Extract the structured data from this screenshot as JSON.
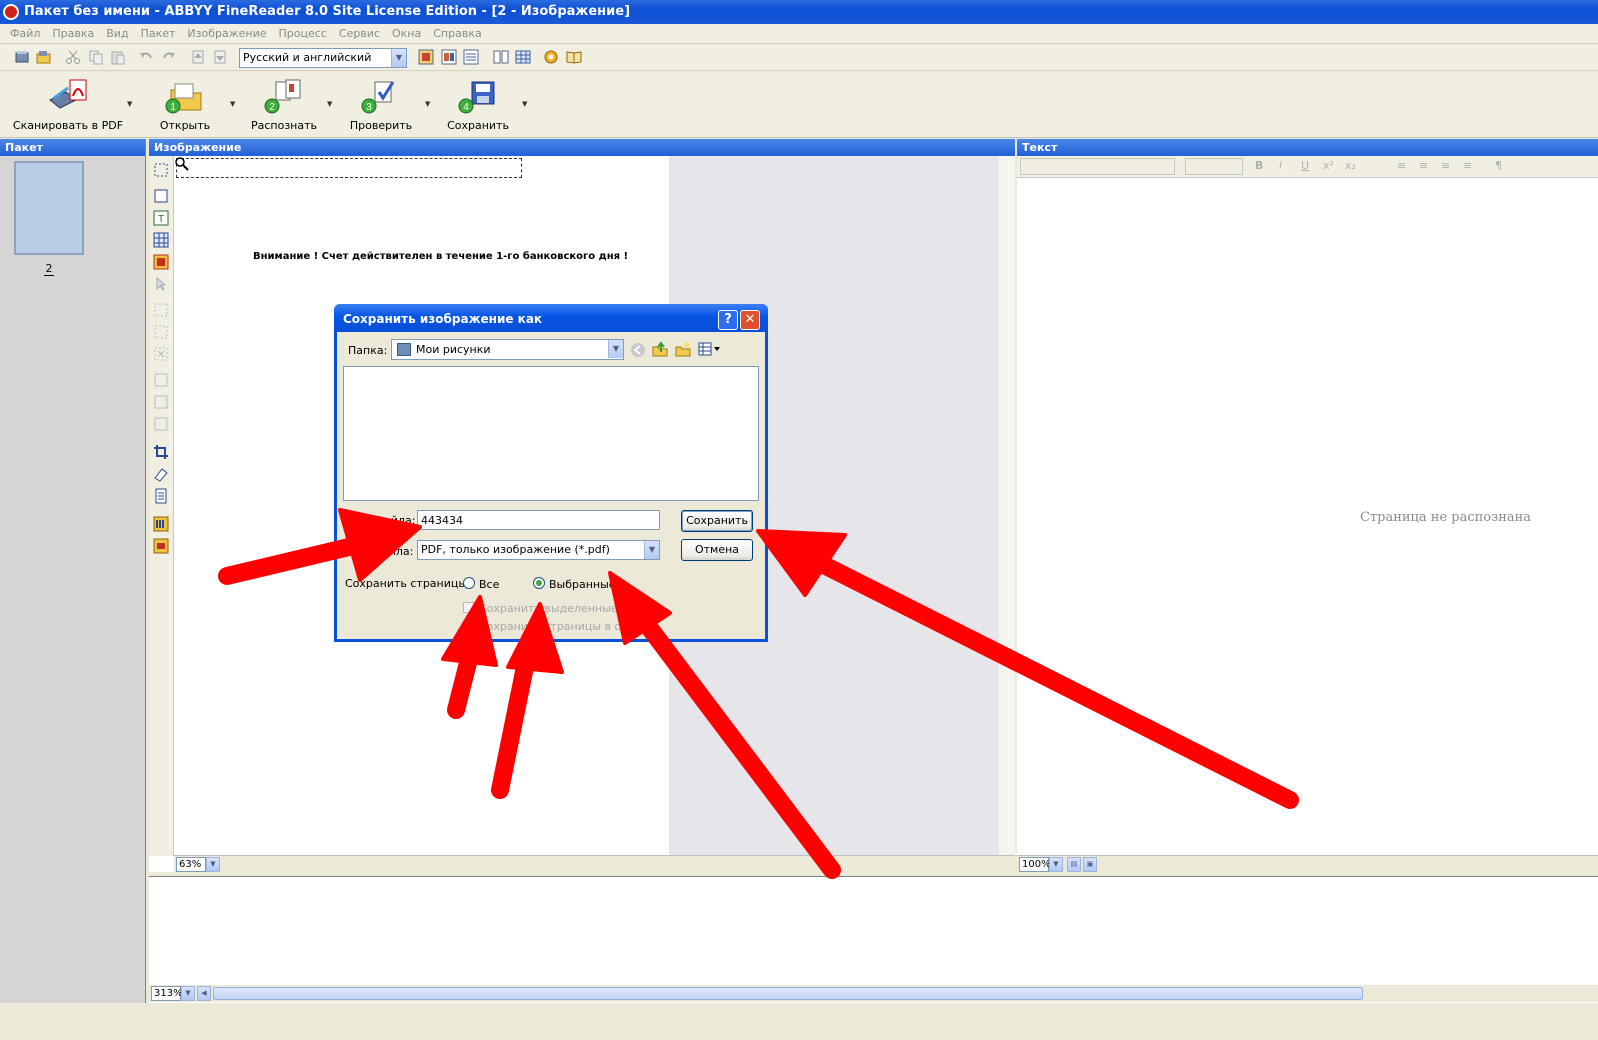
{
  "window": {
    "title": "Пакет без имени - ABBYY FineReader 8.0 Site License Edition - [2 - Изображение]"
  },
  "menu": [
    "Файл",
    "Правка",
    "Вид",
    "Пакет",
    "Изображение",
    "Процесс",
    "Сервис",
    "Окна",
    "Справка"
  ],
  "toolbar": {
    "language": "Русский и английский",
    "scan_label": "Сканировать в PDF",
    "open_label": "Открыть",
    "recognize_label": "Распознать",
    "check_label": "Проверить",
    "save_label": "Сохранить",
    "open_step": "1",
    "recognize_step": "2",
    "check_step": "3",
    "save_step": "4"
  },
  "panes": {
    "packet": "Пакет",
    "image": "Изображение",
    "text": "Текст"
  },
  "packet": {
    "thumb_number": "2"
  },
  "image": {
    "notice": "Внимание !  Счет действителен в течение 1-го банковского дня !",
    "zoom": "63%"
  },
  "text": {
    "status": "Страница не распознана",
    "zoom": "100%"
  },
  "zoom_pane": {
    "zoom": "313%"
  },
  "dialog": {
    "title": "Сохранить изображение как",
    "folder_label": "Папка:",
    "folder_value": "Мои рисунки",
    "filename_label": "Имя файла:",
    "filename_value": "443434",
    "filetype_label": "Тип файла:",
    "filetype_value": "PDF, только изображение (*.pdf)",
    "save_button": "Сохранить",
    "cancel_button": "Отмена",
    "save_pages_label": "Сохранить страницы:",
    "radio_all": "Все",
    "radio_selected": "Выбранные",
    "check_1": "Сохранить выделенные б",
    "check_2": "Сохранить страницы в оди"
  },
  "colors": {
    "accent": "#0a51d9",
    "arrow": "#ff0000"
  }
}
